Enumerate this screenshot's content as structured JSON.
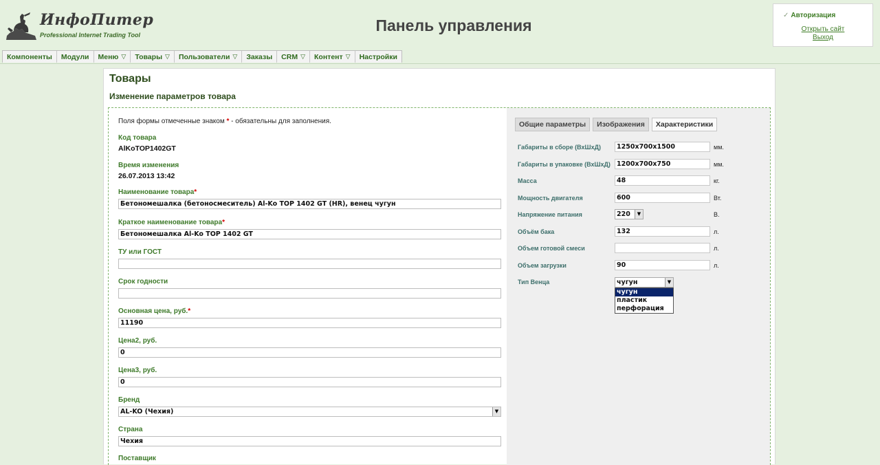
{
  "header": {
    "logo_name": "ИнфоПитер",
    "logo_tagline": "Professional Internet Trading Tool",
    "page_heading": "Панель управления"
  },
  "auth": {
    "title": "Авторизация",
    "open_site": "Открыть сайт",
    "logout": "Выход"
  },
  "nav": {
    "items": [
      {
        "label": "Компоненты"
      },
      {
        "label": "Модули"
      },
      {
        "label": "Меню",
        "arrow": "▽"
      },
      {
        "label": "Товары",
        "arrow": "▽"
      },
      {
        "label": "Пользователи",
        "arrow": "▽"
      },
      {
        "label": "Заказы"
      },
      {
        "label": "CRM",
        "arrow": "▽"
      },
      {
        "label": "Контент",
        "arrow": "▽"
      },
      {
        "label": "Настройки"
      }
    ]
  },
  "main": {
    "title": "Товары",
    "subtitle": "Изменение параметров товара",
    "note_prefix": "Поля формы отмеченные знаком ",
    "note_star": "*",
    "note_suffix": " - обязательны для заполнения.",
    "fields": {
      "code": {
        "label": "Код товара",
        "value": "AlKoTOP1402GT"
      },
      "modified": {
        "label": "Время изменения",
        "value": "26.07.2013 13:42"
      },
      "name": {
        "label": "Наименование товара",
        "star": "*",
        "value": "Бетономешалка (бетоносмеситель) Al-Ko TOP 1402 GT (HR), венец чугун"
      },
      "short_name": {
        "label": "Краткое наименование товара",
        "star": "*",
        "value": "Бетономешалка Al-Ko TOP 1402 GT"
      },
      "tu_gost": {
        "label": "ТУ или ГОСТ",
        "value": ""
      },
      "shelf_life": {
        "label": "Срок годности",
        "value": ""
      },
      "price": {
        "label": "Основная цена, руб.",
        "star": "*",
        "value": "11190"
      },
      "price2": {
        "label": "Цена2, руб.",
        "value": "0"
      },
      "price3": {
        "label": "Цена3, руб.",
        "value": "0"
      },
      "brand": {
        "label": "Бренд",
        "value": "AL-KO (Чехия)"
      },
      "country": {
        "label": "Страна",
        "value": "Чехия"
      },
      "supplier": {
        "label": "Поставщик"
      }
    }
  },
  "tabs": [
    {
      "label": "Общие параметры"
    },
    {
      "label": "Изображения"
    },
    {
      "label": "Характеристики"
    }
  ],
  "specs": {
    "dims_assembled": {
      "label": "Габариты в сборе (ВхШхД)",
      "value": "1250x700x1500",
      "unit": "мм."
    },
    "dims_packed": {
      "label": "Габариты в упаковке (ВхШхД)",
      "value": "1200x700x750",
      "unit": "мм."
    },
    "mass": {
      "label": "Масса",
      "value": "48",
      "unit": "кг."
    },
    "power": {
      "label": "Мощность двигателя",
      "value": "600",
      "unit": "Вт."
    },
    "voltage": {
      "label": "Напряжение питания",
      "value": "220",
      "unit": "В."
    },
    "tank": {
      "label": "Объём бака",
      "value": "132",
      "unit": "л."
    },
    "mix_volume": {
      "label": "Объем готовой смеси",
      "value": "",
      "unit": "л."
    },
    "load_volume": {
      "label": "Объем загрузки",
      "value": "90",
      "unit": "л."
    },
    "crown_type": {
      "label": "Тип Венца",
      "value": "чугун",
      "options": [
        "чугун",
        "пластик",
        "перфорация"
      ]
    }
  }
}
